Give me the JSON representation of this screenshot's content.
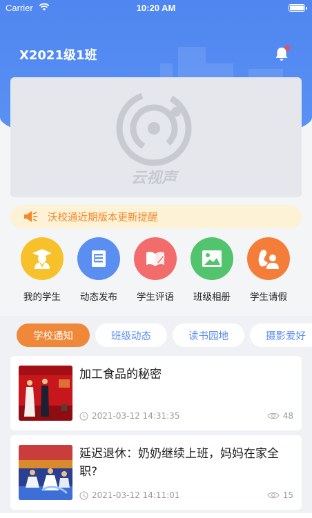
{
  "status_bar": {
    "carrier": "Carrier",
    "time": "10:20 AM"
  },
  "header": {
    "class_name": "X2021级1班"
  },
  "banner": {
    "logo_text": "云视声"
  },
  "notice": {
    "text": "沃校通近期版本更新提醒"
  },
  "menu": [
    {
      "label": "我的学生",
      "color": "#f6c12a"
    },
    {
      "label": "动态发布",
      "color": "#5b8ef1"
    },
    {
      "label": "学生评语",
      "color": "#f36c6c"
    },
    {
      "label": "班级相册",
      "color": "#52c46d"
    },
    {
      "label": "学生请假",
      "color": "#f47d3a"
    }
  ],
  "tabs": [
    {
      "label": "学校通知",
      "active": true
    },
    {
      "label": "班级动态",
      "active": false
    },
    {
      "label": "读书园地",
      "active": false
    },
    {
      "label": "摄影爱好",
      "active": false
    }
  ],
  "articles": [
    {
      "title": "加工食品的秘密",
      "date": "2021-03-12 14:31:35",
      "views": "48"
    },
    {
      "title": "延迟退休：奶奶继续上班，妈妈在家全职?",
      "date": "2021-03-12 14:11:01",
      "views": "15"
    }
  ],
  "colors": {
    "primary": "#4f86f0",
    "accent": "#f0883a",
    "notice_text": "#f08a2a"
  }
}
